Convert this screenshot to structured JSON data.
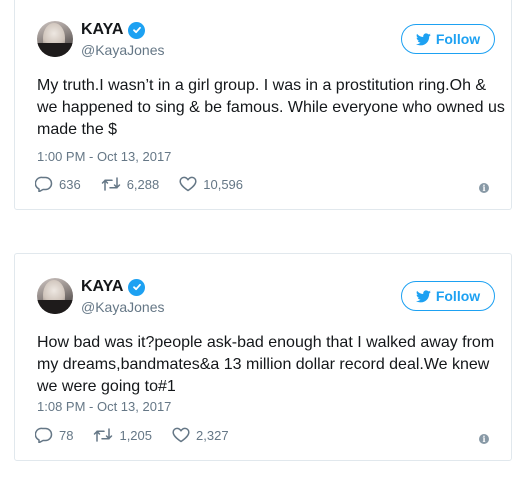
{
  "colors": {
    "accent": "#1da1f2",
    "muted": "#657786",
    "border": "#e1e8ed"
  },
  "tweets": [
    {
      "display_name": "KAYA",
      "handle": "@KayaJones",
      "follow_label": "Follow",
      "text": "My truth.I wasn’t in a girl group. I was in a prostitution ring.Oh & we happened to sing & be famous. While everyone who owned us made the $",
      "timestamp": "1:00 PM - Oct 13, 2017",
      "replies": "636",
      "retweets": "6,288",
      "likes": "10,596"
    },
    {
      "display_name": "KAYA",
      "handle": "@KayaJones",
      "follow_label": "Follow",
      "text": "How bad was it?people ask-bad enough that I walked away from my dreams,bandmates&a 13 million dollar record deal.We knew we were going to#1",
      "timestamp": "1:08 PM - Oct 13, 2017",
      "replies": "78",
      "retweets": "1,205",
      "likes": "2,327"
    }
  ],
  "icons": [
    "verified-badge-icon",
    "twitter-bird-icon",
    "reply-icon",
    "retweet-icon",
    "like-icon",
    "info-icon"
  ]
}
